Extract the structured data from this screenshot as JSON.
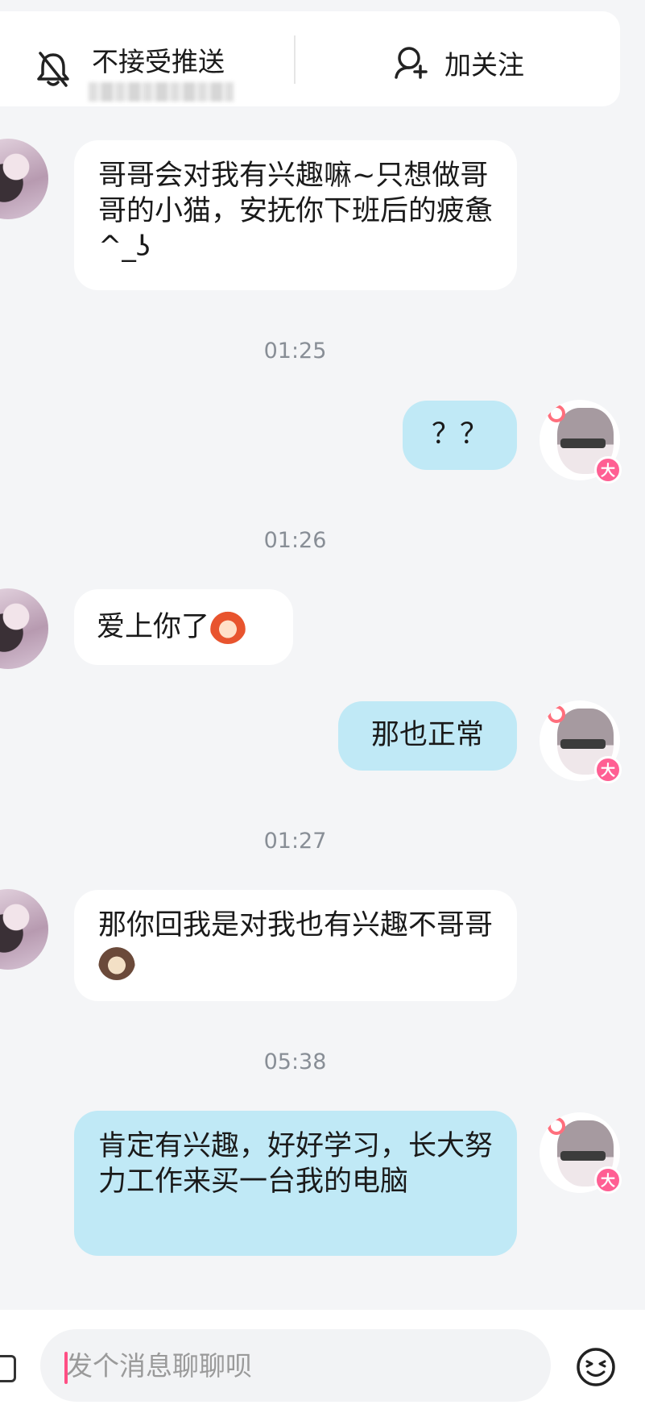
{
  "header": {
    "push_label": "不接受推送",
    "follow_label": "加关注"
  },
  "messages": [
    {
      "from": "other",
      "text": "哥哥会对我有兴趣嘛~只想做哥哥的小猫，安抚你下班后的疲惫^_ʖ"
    },
    {
      "time": "01:25"
    },
    {
      "from": "me",
      "text": "？？"
    },
    {
      "time": "01:26"
    },
    {
      "from": "other",
      "text": "爱上你了",
      "sticker": "girl-emoji-icon"
    },
    {
      "from": "me",
      "text": "那也正常"
    },
    {
      "time": "01:27"
    },
    {
      "from": "other",
      "text": "那你回我是对我也有兴趣不哥哥",
      "sticker": "bunny-emoji-icon"
    },
    {
      "time": "05:38"
    },
    {
      "from": "me",
      "text": "肯定有兴趣，好好学习，长大努力工作来买一台我的电脑"
    }
  ],
  "badge_label": "大",
  "composer": {
    "placeholder": "发个消息聊聊呗"
  },
  "colors": {
    "outgoing_bubble": "#c0e9f6",
    "incoming_bubble": "#ffffff",
    "badge": "#ff5f93",
    "caret": "#ff4f84"
  }
}
